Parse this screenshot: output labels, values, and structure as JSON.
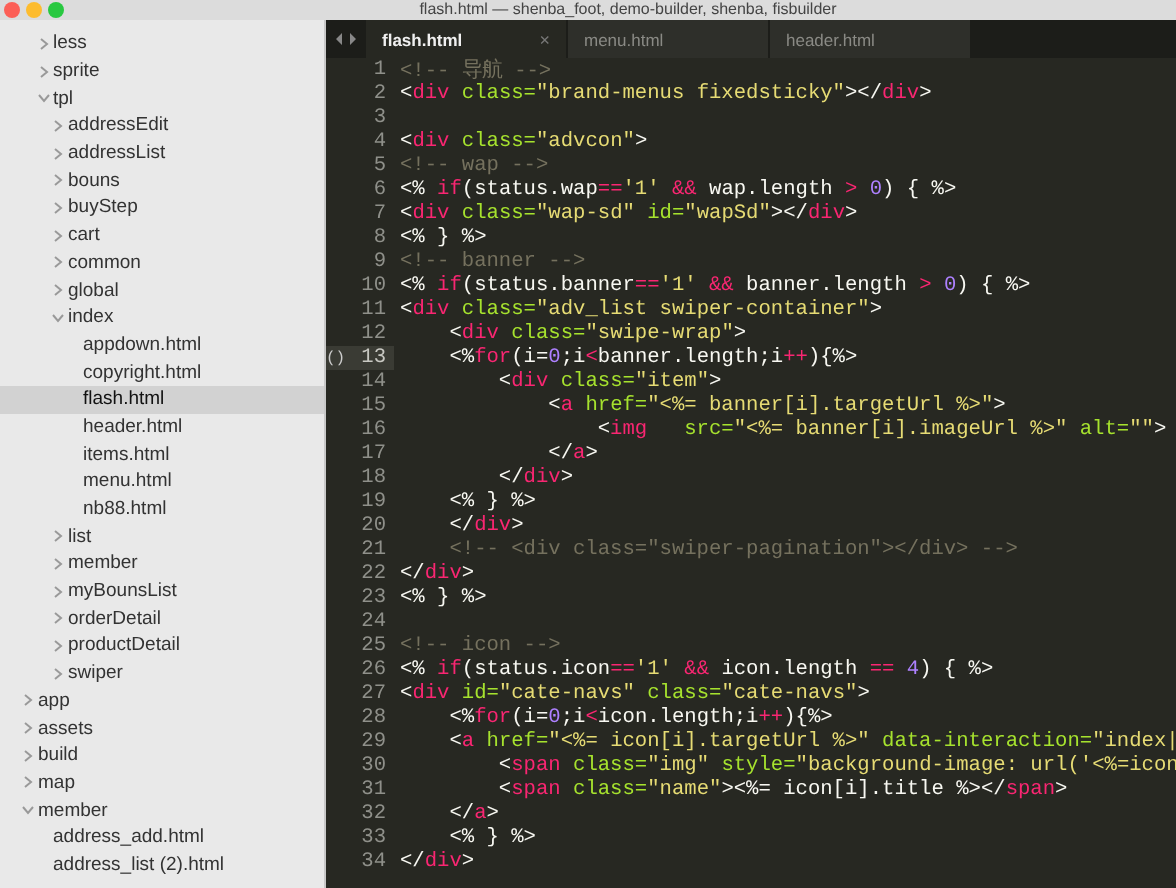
{
  "window": {
    "title": "flash.html — shenba_foot, demo-builder, shenba, fisbuilder"
  },
  "sidebar": {
    "items": [
      {
        "children": [
          {
            "kind": "folder",
            "label": "less",
            "expanded": false,
            "selected": false
          },
          {
            "kind": "folder",
            "label": "sprite",
            "expanded": false,
            "selected": false
          },
          {
            "kind": "folder",
            "label": "tpl",
            "expanded": true,
            "selected": false,
            "children": [
              {
                "kind": "folder",
                "label": "addressEdit",
                "expanded": false,
                "selected": false
              },
              {
                "kind": "folder",
                "label": "addressList",
                "expanded": false,
                "selected": false
              },
              {
                "kind": "folder",
                "label": "bouns",
                "expanded": false,
                "selected": false
              },
              {
                "kind": "folder",
                "label": "buyStep",
                "expanded": false,
                "selected": false
              },
              {
                "kind": "folder",
                "label": "cart",
                "expanded": false,
                "selected": false
              },
              {
                "kind": "folder",
                "label": "common",
                "expanded": false,
                "selected": false
              },
              {
                "kind": "folder",
                "label": "global",
                "expanded": false,
                "selected": false
              },
              {
                "kind": "folder",
                "label": "index",
                "expanded": true,
                "selected": false,
                "children": [
                  {
                    "kind": "file",
                    "label": "appdown.html",
                    "selected": false
                  },
                  {
                    "kind": "file",
                    "label": "copyright.html",
                    "selected": false
                  },
                  {
                    "kind": "file",
                    "label": "flash.html",
                    "selected": true
                  },
                  {
                    "kind": "file",
                    "label": "header.html",
                    "selected": false
                  },
                  {
                    "kind": "file",
                    "label": "items.html",
                    "selected": false
                  },
                  {
                    "kind": "file",
                    "label": "menu.html",
                    "selected": false
                  },
                  {
                    "kind": "file",
                    "label": "nb88.html",
                    "selected": false
                  }
                ]
              },
              {
                "kind": "folder",
                "label": "list",
                "expanded": false,
                "selected": false
              },
              {
                "kind": "folder",
                "label": "member",
                "expanded": false,
                "selected": false
              },
              {
                "kind": "folder",
                "label": "myBounsList",
                "expanded": false,
                "selected": false
              },
              {
                "kind": "folder",
                "label": "orderDetail",
                "expanded": false,
                "selected": false
              },
              {
                "kind": "folder",
                "label": "productDetail",
                "expanded": false,
                "selected": false
              },
              {
                "kind": "folder",
                "label": "swiper",
                "expanded": false,
                "selected": false
              }
            ]
          }
        ]
      },
      {
        "kind": "folder",
        "label": "app",
        "expanded": false,
        "selected": false
      },
      {
        "kind": "folder",
        "label": "assets",
        "expanded": false,
        "selected": false
      },
      {
        "kind": "folder",
        "label": "build",
        "expanded": false,
        "selected": false
      },
      {
        "kind": "folder",
        "label": "map",
        "expanded": false,
        "selected": false
      },
      {
        "kind": "folder",
        "label": "member",
        "expanded": true,
        "selected": false,
        "children": [
          {
            "kind": "file",
            "label": "address_add.html",
            "selected": false
          },
          {
            "kind": "file",
            "label": "address_list (2).html",
            "selected": false
          }
        ]
      }
    ]
  },
  "tabs": [
    {
      "label": "flash.html",
      "selected": true,
      "close": "×"
    },
    {
      "label": "menu.html",
      "selected": false
    },
    {
      "label": "header.html",
      "selected": false
    }
  ],
  "editor": {
    "lines": [
      {
        "number": "1",
        "current": false,
        "tokens": [
          {
            "kind": "comment",
            "text": "<!-- 导航 -->"
          }
        ]
      },
      {
        "number": "2",
        "current": false,
        "tokens": [
          {
            "kind": "plain",
            "text": "<"
          },
          {
            "kind": "tag",
            "text": "div"
          },
          {
            "kind": "attr",
            "text": " class="
          },
          {
            "kind": "string",
            "text": "\"brand-menus fixedsticky\""
          },
          {
            "kind": "plain",
            "text": "></"
          },
          {
            "kind": "tag",
            "text": "div"
          },
          {
            "kind": "plain",
            "text": ">"
          }
        ]
      },
      {
        "number": "3",
        "current": false
      },
      {
        "number": "4",
        "current": false,
        "tokens": [
          {
            "kind": "plain",
            "text": "<"
          },
          {
            "kind": "tag",
            "text": "div"
          },
          {
            "kind": "attr",
            "text": " class="
          },
          {
            "kind": "string",
            "text": "\"advcon\""
          },
          {
            "kind": "plain",
            "text": ">"
          }
        ]
      },
      {
        "number": "5",
        "current": false,
        "tokens": [
          {
            "kind": "comment",
            "text": "<!-- wap -->"
          }
        ]
      },
      {
        "number": "6",
        "current": false,
        "tokens": [
          {
            "kind": "plain",
            "text": "<% "
          },
          {
            "kind": "tag",
            "text": "if"
          },
          {
            "kind": "plain",
            "text": "(status.wap"
          },
          {
            "kind": "tag",
            "text": "=="
          },
          {
            "kind": "string",
            "text": "'1'"
          },
          {
            "kind": "tag",
            "text": " && "
          },
          {
            "kind": "plain",
            "text": "wap.length"
          },
          {
            "kind": "tag",
            "text": " > "
          },
          {
            "kind": "number",
            "text": "0"
          },
          {
            "kind": "plain",
            "text": ") { %>"
          }
        ]
      },
      {
        "number": "7",
        "current": false,
        "tokens": [
          {
            "kind": "plain",
            "text": "<"
          },
          {
            "kind": "tag",
            "text": "div"
          },
          {
            "kind": "attr",
            "text": " class="
          },
          {
            "kind": "string",
            "text": "\"wap-sd\""
          },
          {
            "kind": "attr",
            "text": " id="
          },
          {
            "kind": "string",
            "text": "\"wapSd\""
          },
          {
            "kind": "plain",
            "text": "></"
          },
          {
            "kind": "tag",
            "text": "div"
          },
          {
            "kind": "plain",
            "text": ">"
          }
        ]
      },
      {
        "number": "8",
        "current": false,
        "tokens": [
          {
            "kind": "plain",
            "text": "<% } %>"
          }
        ]
      },
      {
        "number": "9",
        "current": false,
        "tokens": [
          {
            "kind": "comment",
            "text": "<!-- banner -->"
          }
        ]
      },
      {
        "number": "10",
        "current": false,
        "tokens": [
          {
            "kind": "plain",
            "text": "<% "
          },
          {
            "kind": "tag",
            "text": "if"
          },
          {
            "kind": "plain",
            "text": "(status.banner"
          },
          {
            "kind": "tag",
            "text": "=="
          },
          {
            "kind": "string",
            "text": "'1'"
          },
          {
            "kind": "tag",
            "text": " && "
          },
          {
            "kind": "plain",
            "text": "banner.length"
          },
          {
            "kind": "tag",
            "text": " > "
          },
          {
            "kind": "number",
            "text": "0"
          },
          {
            "kind": "plain",
            "text": ") { %>"
          }
        ]
      },
      {
        "number": "11",
        "current": false,
        "tokens": [
          {
            "kind": "plain",
            "text": "<"
          },
          {
            "kind": "tag",
            "text": "div"
          },
          {
            "kind": "attr",
            "text": " class="
          },
          {
            "kind": "string",
            "text": "\"adv_list swiper-container\""
          },
          {
            "kind": "plain",
            "text": ">"
          }
        ]
      },
      {
        "number": "12",
        "current": false,
        "tokens": [
          {
            "kind": "plain",
            "text": "    <"
          },
          {
            "kind": "tag",
            "text": "div"
          },
          {
            "kind": "attr",
            "text": " class="
          },
          {
            "kind": "string",
            "text": "\"swipe-wrap\""
          },
          {
            "kind": "plain",
            "text": ">"
          }
        ]
      },
      {
        "number": "13",
        "current": true,
        "gutter_mark": "()",
        "tokens": [
          {
            "kind": "plain",
            "text": "    <%"
          },
          {
            "kind": "tag",
            "text": "for"
          },
          {
            "kind": "plain",
            "text": "(i="
          },
          {
            "kind": "number",
            "text": "0"
          },
          {
            "kind": "plain",
            "text": ";i"
          },
          {
            "kind": "tag",
            "text": "<"
          },
          {
            "kind": "plain",
            "text": "banner.length;i"
          },
          {
            "kind": "tag",
            "text": "++"
          },
          {
            "kind": "plain",
            "text": "){%>"
          }
        ]
      },
      {
        "number": "14",
        "current": false,
        "tokens": [
          {
            "kind": "plain",
            "text": "        <"
          },
          {
            "kind": "tag",
            "text": "div"
          },
          {
            "kind": "attr",
            "text": " class="
          },
          {
            "kind": "string",
            "text": "\"item\""
          },
          {
            "kind": "plain",
            "text": ">"
          }
        ]
      },
      {
        "number": "15",
        "current": false,
        "tokens": [
          {
            "kind": "plain",
            "text": "            <"
          },
          {
            "kind": "tag",
            "text": "a"
          },
          {
            "kind": "attr",
            "text": " href="
          },
          {
            "kind": "string",
            "text": "\"<%= banner[i].targetUrl %>\""
          },
          {
            "kind": "plain",
            "text": ">"
          }
        ]
      },
      {
        "number": "16",
        "current": false,
        "tokens": [
          {
            "kind": "plain",
            "text": "                <"
          },
          {
            "kind": "tag",
            "text": "img"
          },
          {
            "kind": "attr",
            "text": "   src="
          },
          {
            "kind": "string",
            "text": "\"<%= banner[i].imageUrl %>\""
          },
          {
            "kind": "attr",
            "text": " alt="
          },
          {
            "kind": "string",
            "text": "\"\""
          },
          {
            "kind": "plain",
            "text": ">"
          }
        ]
      },
      {
        "number": "17",
        "current": false,
        "tokens": [
          {
            "kind": "plain",
            "text": "            </"
          },
          {
            "kind": "tag",
            "text": "a"
          },
          {
            "kind": "plain",
            "text": ">"
          }
        ]
      },
      {
        "number": "18",
        "current": false,
        "tokens": [
          {
            "kind": "plain",
            "text": "        </"
          },
          {
            "kind": "tag",
            "text": "div"
          },
          {
            "kind": "plain",
            "text": ">"
          }
        ]
      },
      {
        "number": "19",
        "current": false,
        "tokens": [
          {
            "kind": "plain",
            "text": "    <% } %>"
          }
        ]
      },
      {
        "number": "20",
        "current": false,
        "tokens": [
          {
            "kind": "plain",
            "text": "    </"
          },
          {
            "kind": "tag",
            "text": "div"
          },
          {
            "kind": "plain",
            "text": ">"
          }
        ]
      },
      {
        "number": "21",
        "current": false,
        "tokens": [
          {
            "kind": "comment",
            "text": "    <!-- <div class=\"swiper-pagination\"></div> -->"
          }
        ]
      },
      {
        "number": "22",
        "current": false,
        "tokens": [
          {
            "kind": "plain",
            "text": "</"
          },
          {
            "kind": "tag",
            "text": "div"
          },
          {
            "kind": "plain",
            "text": ">"
          }
        ]
      },
      {
        "number": "23",
        "current": false,
        "tokens": [
          {
            "kind": "plain",
            "text": "<% } %>"
          }
        ]
      },
      {
        "number": "24",
        "current": false
      },
      {
        "number": "25",
        "current": false,
        "tokens": [
          {
            "kind": "comment",
            "text": "<!-- icon -->"
          }
        ]
      },
      {
        "number": "26",
        "current": false,
        "tokens": [
          {
            "kind": "plain",
            "text": "<% "
          },
          {
            "kind": "tag",
            "text": "if"
          },
          {
            "kind": "plain",
            "text": "(status.icon"
          },
          {
            "kind": "tag",
            "text": "=="
          },
          {
            "kind": "string",
            "text": "'1'"
          },
          {
            "kind": "tag",
            "text": " && "
          },
          {
            "kind": "plain",
            "text": "icon.length"
          },
          {
            "kind": "tag",
            "text": " == "
          },
          {
            "kind": "number",
            "text": "4"
          },
          {
            "kind": "plain",
            "text": ") { %>"
          }
        ]
      },
      {
        "number": "27",
        "current": false,
        "tokens": [
          {
            "kind": "plain",
            "text": "<"
          },
          {
            "kind": "tag",
            "text": "div"
          },
          {
            "kind": "attr",
            "text": " id="
          },
          {
            "kind": "string",
            "text": "\"cate-navs\""
          },
          {
            "kind": "attr",
            "text": " class="
          },
          {
            "kind": "string",
            "text": "\"cate-navs\""
          },
          {
            "kind": "plain",
            "text": ">"
          }
        ]
      },
      {
        "number": "28",
        "current": false,
        "tokens": [
          {
            "kind": "plain",
            "text": "    <%"
          },
          {
            "kind": "tag",
            "text": "for"
          },
          {
            "kind": "plain",
            "text": "(i="
          },
          {
            "kind": "number",
            "text": "0"
          },
          {
            "kind": "plain",
            "text": ";i"
          },
          {
            "kind": "tag",
            "text": "<"
          },
          {
            "kind": "plain",
            "text": "icon.length;i"
          },
          {
            "kind": "tag",
            "text": "++"
          },
          {
            "kind": "plain",
            "text": "){%>"
          }
        ]
      },
      {
        "number": "29",
        "current": false,
        "tokens": [
          {
            "kind": "plain",
            "text": "    <"
          },
          {
            "kind": "tag",
            "text": "a"
          },
          {
            "kind": "attr",
            "text": " href="
          },
          {
            "kind": "string",
            "text": "\"<%= icon[i].targetUrl %>\""
          },
          {
            "kind": "attr",
            "text": " data-interaction="
          },
          {
            "kind": "string",
            "text": "\"index|"
          }
        ]
      },
      {
        "number": "30",
        "current": false,
        "tokens": [
          {
            "kind": "plain",
            "text": "        <"
          },
          {
            "kind": "tag",
            "text": "span"
          },
          {
            "kind": "attr",
            "text": " class="
          },
          {
            "kind": "string",
            "text": "\"img\""
          },
          {
            "kind": "attr",
            "text": " style="
          },
          {
            "kind": "string",
            "text": "\"background-image: url('<%=icon"
          }
        ]
      },
      {
        "number": "31",
        "current": false,
        "tokens": [
          {
            "kind": "plain",
            "text": "        <"
          },
          {
            "kind": "tag",
            "text": "span"
          },
          {
            "kind": "attr",
            "text": " class="
          },
          {
            "kind": "string",
            "text": "\"name\""
          },
          {
            "kind": "plain",
            "text": "><%= icon[i].title %></"
          },
          {
            "kind": "tag",
            "text": "span"
          },
          {
            "kind": "plain",
            "text": ">"
          }
        ]
      },
      {
        "number": "32",
        "current": false,
        "tokens": [
          {
            "kind": "plain",
            "text": "    </"
          },
          {
            "kind": "tag",
            "text": "a"
          },
          {
            "kind": "plain",
            "text": ">"
          }
        ]
      },
      {
        "number": "33",
        "current": false,
        "tokens": [
          {
            "kind": "plain",
            "text": "    <% } %>"
          }
        ]
      },
      {
        "number": "34",
        "current": false,
        "tokens": [
          {
            "kind": "plain",
            "text": "</"
          },
          {
            "kind": "tag",
            "text": "div"
          },
          {
            "kind": "plain",
            "text": ">"
          }
        ]
      }
    ]
  }
}
